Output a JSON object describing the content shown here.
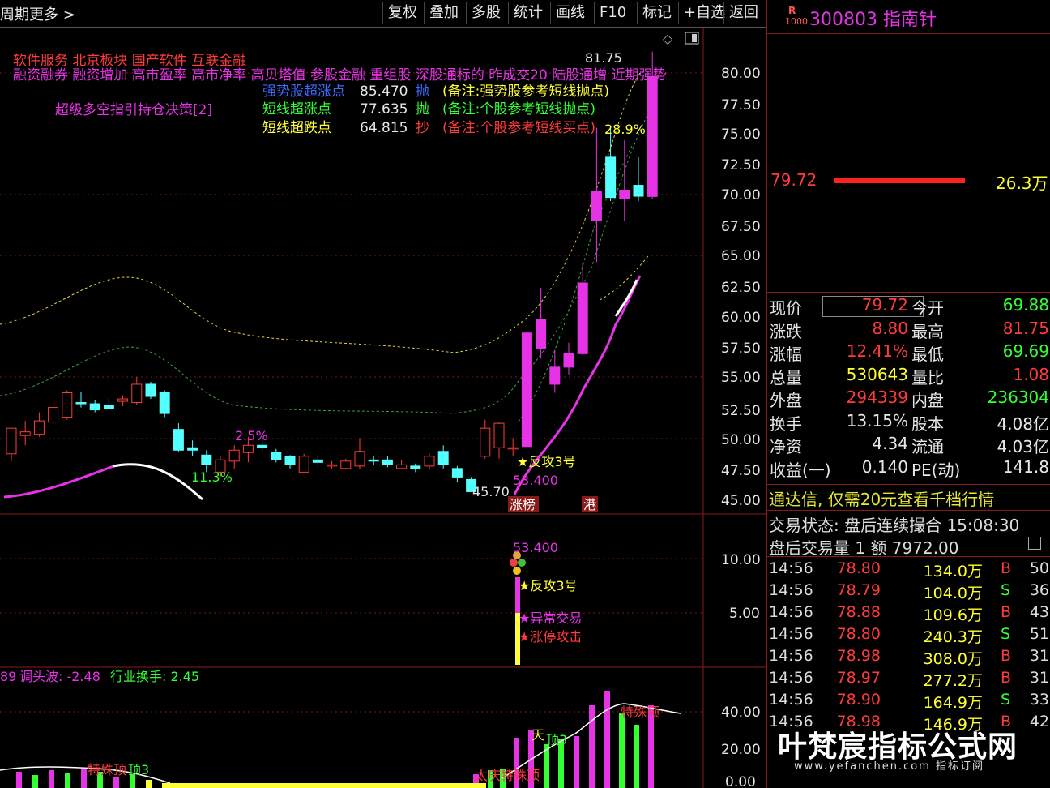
{
  "toolbar": {
    "period": "周期",
    "more": "更多",
    "buttons": [
      "复权",
      "叠加",
      "多股",
      "统计",
      "画线",
      "F10",
      "标记",
      "+自选",
      "返回"
    ]
  },
  "stock": {
    "badge_r": "R",
    "badge_num": "1000",
    "code_name": "300803 指南针"
  },
  "price_axis": [
    "80.00",
    "77.50",
    "75.00",
    "72.50",
    "70.00",
    "67.50",
    "65.00",
    "62.50",
    "60.00",
    "57.50",
    "55.00",
    "52.50",
    "50.00",
    "47.50",
    "45.00"
  ],
  "overlay_text": {
    "tags_red": "软件服务  北京板块  国产软件 互联金融",
    "tags_magenta": "融资融券 融资增加 高市盈率 高市净率 高贝塔值 参股金融 重组股 深股通标的 昨成交20 陆股通增 近期强势",
    "strategy": "超级多空指引持仓决策[2]",
    "rows": [
      {
        "name": "强势股超涨点",
        "value": "85.470",
        "action": "抛",
        "note": "(备注:强势股参考短线抛点)"
      },
      {
        "name": "短线超涨点",
        "value": "77.635",
        "action": "抛",
        "note": "(备注:个股参考短线抛点)"
      },
      {
        "name": "短线超跌点",
        "value": "64.815",
        "action": "抄",
        "note": "(备注:个股参考短线买点)"
      }
    ],
    "high_label": "81.75",
    "pct_label": "28.9%",
    "low_label": "45.70",
    "pct_25": "2.5%",
    "pct_113": "11.3%",
    "fangong": "★反攻3号",
    "val_534": "53.400",
    "zhangbang": "涨榜",
    "gang": "港"
  },
  "mid_panel": {
    "axis": [
      "10.00",
      "5.00"
    ],
    "val_534": "53.400",
    "fangong": "★反攻3号",
    "yichang": "★异常交易",
    "zhangting": "★涨停攻击"
  },
  "bottom_panel": {
    "header_num": "89",
    "header_a": "调头波: -2.48",
    "header_b": "行业换手: 2.45",
    "axis": [
      "40.00",
      "20.00",
      "0.00"
    ],
    "label_tezhu1": "特殊顶",
    "label_tian": "天",
    "label_ding3": "顶3",
    "label_tezhu2": "特殊顶",
    "label_ding3b": "顶3",
    "label_taiqing": "太庆特殊顶"
  },
  "quote": {
    "bar_price": "79.72",
    "bar_vol": "26.3万",
    "fields": [
      {
        "k1": "现价",
        "v1": "79.72",
        "c1": "red",
        "k2": "今开",
        "v2": "69.88",
        "c2": "grn"
      },
      {
        "k1": "涨跌",
        "v1": "8.80",
        "c1": "red",
        "k2": "最高",
        "v2": "81.75",
        "c2": "red"
      },
      {
        "k1": "涨幅",
        "v1": "12.41%",
        "c1": "red",
        "k2": "最低",
        "v2": "69.69",
        "c2": "grn"
      },
      {
        "k1": "总量",
        "v1": "530643",
        "c1": "yel",
        "k2": "量比",
        "v2": "1.08",
        "c2": "red"
      },
      {
        "k1": "外盘",
        "v1": "294339",
        "c1": "red",
        "k2": "内盘",
        "v2": "236304",
        "c2": "grn"
      },
      {
        "k1": "换手",
        "v1": "13.15%",
        "c1": "wht",
        "k2": "股本",
        "v2": "4.08亿",
        "c2": "wht"
      },
      {
        "k1": "净资",
        "v1": "4.34",
        "c1": "wht",
        "k2": "流通",
        "v2": "4.03亿",
        "c2": "wht"
      },
      {
        "k1": "收益(一)",
        "v1": "0.140",
        "c1": "wht",
        "k2": "PE(动)",
        "v2": "141.8",
        "c2": "wht"
      }
    ],
    "ad": "通达信, 仅需20元查看千档行情",
    "trade_status": "交易状态: 盘后连续撮合 15:08:30",
    "after_vol": "盘后交易量 1 额 7972.00"
  },
  "ticks": [
    {
      "t": "14:56",
      "p": "78.80",
      "a": "134.0万",
      "s": "B",
      "n": "50"
    },
    {
      "t": "14:56",
      "p": "78.79",
      "a": "104.0万",
      "s": "S",
      "n": "36"
    },
    {
      "t": "14:56",
      "p": "78.88",
      "a": "109.6万",
      "s": "B",
      "n": "43"
    },
    {
      "t": "14:56",
      "p": "78.80",
      "a": "240.3万",
      "s": "S",
      "n": "51"
    },
    {
      "t": "14:56",
      "p": "78.98",
      "a": "308.0万",
      "s": "B",
      "n": "31"
    },
    {
      "t": "14:56",
      "p": "78.97",
      "a": "277.2万",
      "s": "B",
      "n": "31"
    },
    {
      "t": "14:56",
      "p": "78.90",
      "a": "164.9万",
      "s": "S",
      "n": "33"
    },
    {
      "t": "14:56",
      "p": "78.98",
      "a": "146.9万",
      "s": "B",
      "n": "42"
    }
  ],
  "watermark": {
    "main": "叶梵宸指标公式网",
    "sub": "www.yefanchen.com 指标订阅"
  },
  "chart_data": {
    "type": "candlestick",
    "title": "",
    "ylim": [
      45.0,
      81.75
    ],
    "candles": [
      [
        48.8,
        50.9,
        48.2,
        50.9
      ],
      [
        50.3,
        50.6,
        49.5,
        51.5
      ],
      [
        50.4,
        51.5,
        50.2,
        52.2
      ],
      [
        51.4,
        52.6,
        51.2,
        53.2
      ],
      [
        51.8,
        53.8,
        51.6,
        54.0
      ],
      [
        53.0,
        52.9,
        52.6,
        53.9
      ],
      [
        52.9,
        52.4,
        52.2,
        53.2
      ],
      [
        52.8,
        52.5,
        52.4,
        53.4
      ],
      [
        53.1,
        53.3,
        52.7,
        53.6
      ],
      [
        53.0,
        54.5,
        52.8,
        55.1
      ],
      [
        54.5,
        53.5,
        53.3,
        54.7
      ],
      [
        53.8,
        52.1,
        51.8,
        54.0
      ],
      [
        50.8,
        49.1,
        49.0,
        51.3
      ],
      [
        49.3,
        49.1,
        48.6,
        49.9
      ],
      [
        48.7,
        47.9,
        47.3,
        49.1
      ],
      [
        47.3,
        48.3,
        46.9,
        48.6
      ],
      [
        48.2,
        49.1,
        47.6,
        49.5
      ],
      [
        48.9,
        49.5,
        48.1,
        50.2
      ],
      [
        49.5,
        49.3,
        48.9,
        50.0
      ],
      [
        48.9,
        48.3,
        48.1,
        49.2
      ],
      [
        48.6,
        47.9,
        47.6,
        48.7
      ],
      [
        47.3,
        48.6,
        47.3,
        48.8
      ],
      [
        48.3,
        48.1,
        47.8,
        48.7
      ],
      [
        47.9,
        47.9,
        47.6,
        48.2
      ],
      [
        47.6,
        48.2,
        47.5,
        48.4
      ],
      [
        47.8,
        49.0,
        47.6,
        50.1
      ],
      [
        48.3,
        48.2,
        47.9,
        48.6
      ],
      [
        48.3,
        47.9,
        47.7,
        48.6
      ],
      [
        47.6,
        47.9,
        47.6,
        48.3
      ],
      [
        47.8,
        47.6,
        47.3,
        48.0
      ],
      [
        47.8,
        48.6,
        47.5,
        48.8
      ],
      [
        49.0,
        47.9,
        47.6,
        49.5
      ],
      [
        47.6,
        46.9,
        46.5,
        47.8
      ],
      [
        46.7,
        45.7,
        45.7,
        46.9
      ],
      [
        48.6,
        50.9,
        48.4,
        51.6
      ],
      [
        49.3,
        51.3,
        48.4,
        51.4
      ],
      [
        49.3,
        49.3,
        48.6,
        50.1
      ],
      [
        49.4,
        58.7,
        49.4,
        58.9
      ],
      [
        57.4,
        59.8,
        56.6,
        62.4
      ],
      [
        54.5,
        55.9,
        53.8,
        57.3
      ],
      [
        55.9,
        57.0,
        55.3,
        57.9
      ],
      [
        57.0,
        62.8,
        56.9,
        64.5
      ],
      [
        67.9,
        70.3,
        64.5,
        75.5
      ],
      [
        73.1,
        69.8,
        69.5,
        75.5
      ],
      [
        69.7,
        70.4,
        67.9,
        74.5
      ],
      [
        70.8,
        69.9,
        69.5,
        73.1
      ],
      [
        69.88,
        79.72,
        69.69,
        81.75
      ]
    ]
  }
}
